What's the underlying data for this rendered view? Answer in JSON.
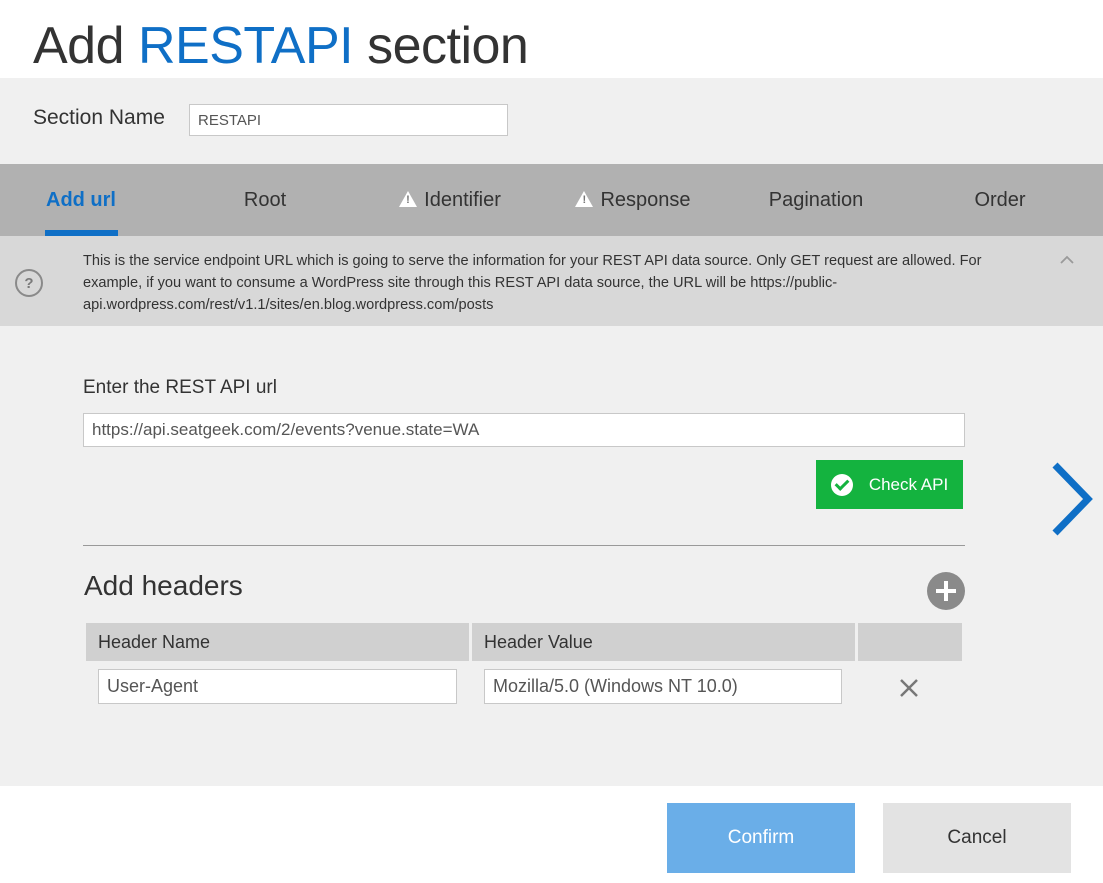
{
  "header": {
    "title_prefix": "Add",
    "title_accent": "RESTAPI",
    "title_suffix": "section"
  },
  "section_name": {
    "label": "Section Name",
    "value": "RESTAPI"
  },
  "tabs": [
    {
      "label": "Add url",
      "active": true,
      "warning": false
    },
    {
      "label": "Root",
      "active": false,
      "warning": false
    },
    {
      "label": "Identifier",
      "active": false,
      "warning": true
    },
    {
      "label": "Response",
      "active": false,
      "warning": true
    },
    {
      "label": "Pagination",
      "active": false,
      "warning": false
    },
    {
      "label": "Order",
      "active": false,
      "warning": false
    }
  ],
  "info": {
    "help_icon_text": "?",
    "text": "This is the service endpoint URL which is going to serve the information for your REST API data source. Only GET request are allowed. For example, if you want to consume a WordPress site through this REST API data source, the URL will be https://public-api.wordpress.com/rest/v1.1/sites/en.blog.wordpress.com/posts"
  },
  "url": {
    "label": "Enter the REST API url",
    "value": "https://api.seatgeek.com/2/events?venue.state=WA"
  },
  "check_api": {
    "label": "Check API"
  },
  "headers": {
    "title": "Add headers",
    "columns": [
      "Header Name",
      "Header Value"
    ],
    "rows": [
      {
        "name": "User-Agent",
        "value": "Mozilla/5.0 (Windows NT 10.0)"
      }
    ]
  },
  "footer": {
    "confirm_label": "Confirm",
    "cancel_label": "Cancel"
  },
  "colors": {
    "accent": "#0f6fc6",
    "success": "#14b33f",
    "confirm": "#6aaee8"
  }
}
